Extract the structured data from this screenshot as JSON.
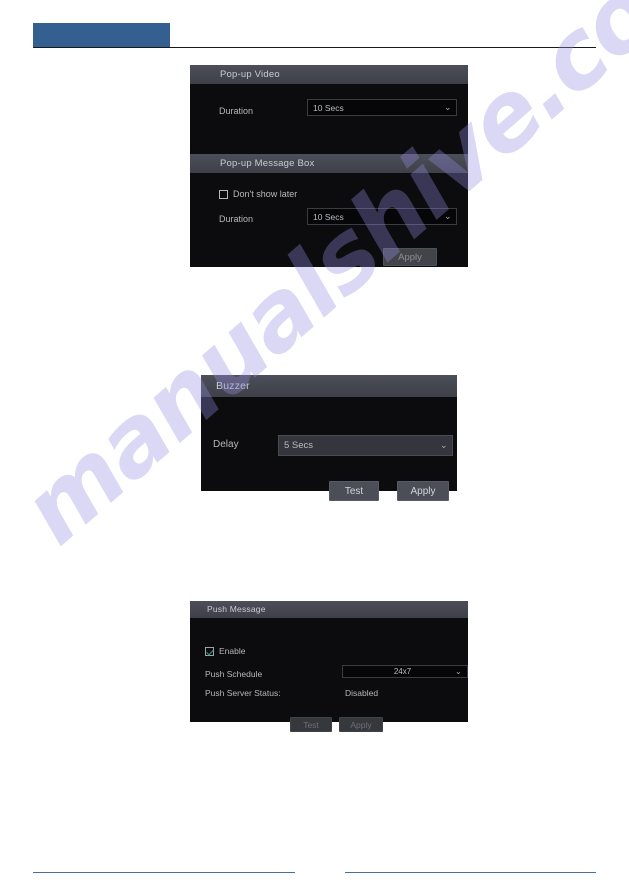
{
  "watermark": {
    "text": "manualshive.com"
  },
  "panels": {
    "popup_video": {
      "title": "Pop-up Video",
      "duration_label": "Duration",
      "duration_value": "10 Secs",
      "chevron": "⌄"
    },
    "popup_message_box": {
      "title": "Pop-up Message Box",
      "dont_show_label": "Don't show later",
      "dont_show_checked": false,
      "duration_label": "Duration",
      "duration_value": "10 Secs",
      "apply_label": "Apply",
      "chevron": "⌄"
    },
    "buzzer": {
      "title": "Buzzer",
      "delay_label": "Delay",
      "delay_value": "5 Secs",
      "test_label": "Test",
      "apply_label": "Apply",
      "chevron": "⌄"
    },
    "push_message": {
      "title": "Push Message",
      "enable_label": "Enable",
      "enable_checked": true,
      "push_schedule_label": "Push Schedule",
      "push_schedule_value": "24x7",
      "push_server_status_label": "Push Server Status:",
      "push_server_status_value": "Disabled",
      "test_label": "Test",
      "apply_label": "Apply",
      "chevron": "⌄"
    }
  },
  "colors": {
    "header_block": "#335f91",
    "footer_rule": "#4a6f96",
    "panel_bg": "#0c0c0e",
    "panel_title_bg": "#44474f",
    "accent_check": "#2e9e8f",
    "watermark": "#968ce1"
  }
}
